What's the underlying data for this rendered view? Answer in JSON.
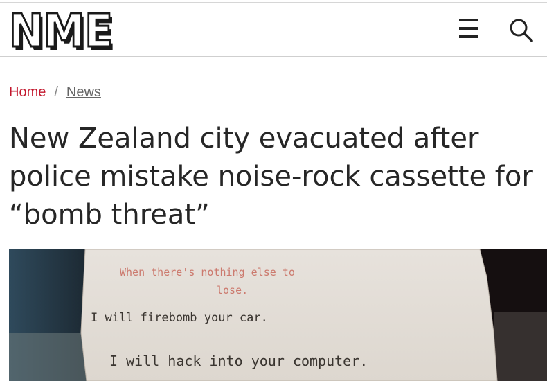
{
  "header": {
    "logo_text": "NME",
    "menu_icon": "hamburger-menu-icon",
    "search_icon": "search-icon"
  },
  "breadcrumb": {
    "home": "Home",
    "separator": "/",
    "current": "News"
  },
  "article": {
    "title_lines": [
      "New Zealand city evacuated after",
      "police mistake noise-rock cassette for",
      "“bomb threat”"
    ]
  },
  "hero_image": {
    "note_lines": [
      "When there's nothing else to",
      "lose.",
      "I will firebomb your car.",
      "I will hack into your computer."
    ]
  },
  "colors": {
    "brand_red": "#c2162c",
    "text_dark": "#262626",
    "typewriter_ink": "#3a3530",
    "typewriter_red": "#c4584a"
  }
}
